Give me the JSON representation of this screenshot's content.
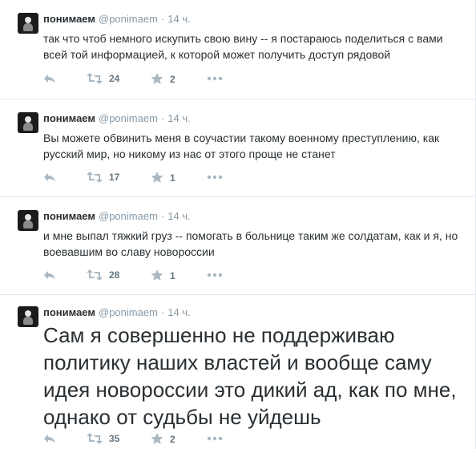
{
  "tweets": [
    {
      "fullname": "понимаем",
      "username": "@ponimaem",
      "separator": "·",
      "time": "14 ч.",
      "text": "так что чтоб немного искупить свою вину -- я постараюсь поделиться с вами всей той информацией, к которой может получить доступ рядовой",
      "retweets": "24",
      "favorites": "2"
    },
    {
      "fullname": "понимаем",
      "username": "@ponimaem",
      "separator": "·",
      "time": "14 ч.",
      "text": "Вы можете обвинить меня в соучастии такому военному преступлению, как русский мир, но никому из нас от этого проще не станет",
      "retweets": "17",
      "favorites": "1"
    },
    {
      "fullname": "понимаем",
      "username": "@ponimaem",
      "separator": "·",
      "time": "14 ч.",
      "text": "и мне выпал тяжкий груз -- помогать в больнице таким же солдатам, как и я, но воевавшим во славу новороссии",
      "retweets": "28",
      "favorites": "1"
    },
    {
      "fullname": "понимаем",
      "username": "@ponimaem",
      "separator": "·",
      "time": "14 ч.",
      "text": "Сам я совершенно не поддерживаю политику наших властей и вообще саму идея новороссии это дикий ад, как по мне, однако от судьбы не уйдешь",
      "retweets": "35",
      "favorites": "2"
    }
  ],
  "icons": {
    "reply": "reply-icon",
    "retweet": "retweet-icon",
    "favorite": "star-icon",
    "more": "more-icon"
  },
  "colors": {
    "icon": "#aab8c2",
    "meta": "#8899a6",
    "text": "#292f33",
    "divider": "#e1e8ed"
  }
}
